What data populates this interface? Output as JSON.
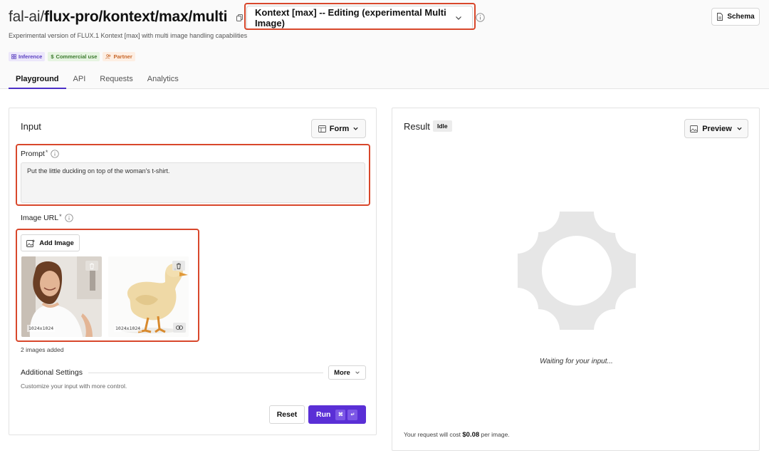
{
  "header": {
    "title_prefix": "fal-ai/",
    "title_main": "flux-pro/kontext/max/multi",
    "variant_selected": "Kontext [max] -- Editing (experimental Multi Image)",
    "schema_label": "Schema",
    "subtitle": "Experimental version of FLUX.1 Kontext [max] with multi image handling capabilities",
    "badges": {
      "inference": "Inference",
      "commercial": "Commercial use",
      "partner": "Partner"
    }
  },
  "tabs": [
    "Playground",
    "API",
    "Requests",
    "Analytics"
  ],
  "input": {
    "title": "Input",
    "form_label": "Form",
    "prompt_label": "Prompt",
    "prompt_required": "*",
    "prompt_value": "Put the little duckling on top of the woman's t-shirt.",
    "image_url_label": "Image URL",
    "image_url_required": "*",
    "add_image_label": "Add Image",
    "images": [
      {
        "size": "1024x1024"
      },
      {
        "size": "1024x1024"
      }
    ],
    "images_added": "2 images added",
    "additional_settings": "Additional Settings",
    "more_label": "More",
    "customize_hint": "Customize your input with more control.",
    "reset_label": "Reset",
    "run_label": "Run",
    "run_kbd_1": "⌘",
    "run_kbd_2": "↵"
  },
  "result": {
    "title": "Result",
    "status": "Idle",
    "preview_label": "Preview",
    "waiting": "Waiting for your input...",
    "cost_prefix": "Your request will cost ",
    "cost_value": "$0.08",
    "cost_suffix": " per image."
  },
  "colors": {
    "accent": "#5a2fd6",
    "annotation": "#d8472b"
  }
}
